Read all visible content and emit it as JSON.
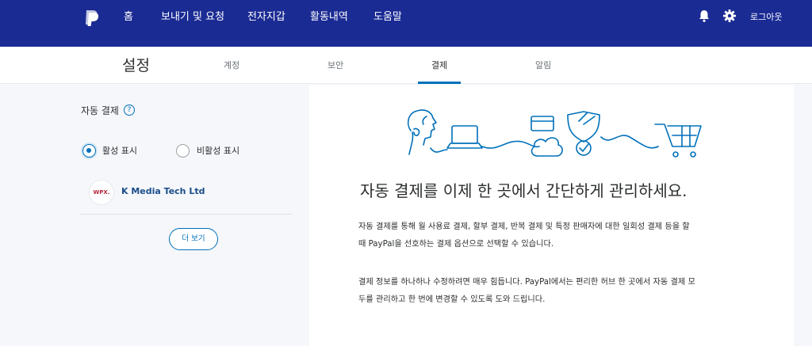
{
  "topnav": {
    "items": [
      "홈",
      "보내기 및 요청",
      "전자지갑",
      "활동내역",
      "도움말"
    ],
    "logout": "로그아웃",
    "icons": [
      "paypal-logo",
      "bell-icon",
      "gear-icon"
    ]
  },
  "subnav": {
    "title": "설정",
    "tabs": [
      "계정",
      "보안",
      "결제",
      "알림"
    ],
    "active_tab": "결제"
  },
  "left": {
    "auto_payments_label": "자동 결제",
    "help_symbol": "?",
    "radio_active_label": "활성 표시",
    "radio_inactive_label": "비활성 표시",
    "merchant_logo_text": "WPX.",
    "merchant_name": "K Media Tech Ltd",
    "more_button": "더 보기"
  },
  "right": {
    "heading": "자동 결제를 이제 한 곳에서 간단하게 관리하세요.",
    "para1_line1": "자동 결제를 통해 월 사용료 결제, 할부 결제, 반복 결제 및 특정 판매자에 대한 일회성 결제 등을 할",
    "para1_line2": "때 PayPal을 선호하는 결제 옵션으로 선택할 수 있습니다.",
    "para2_line1": "결제 정보를 하나하나 수정하려면 매우 힘듭니다. PayPal에서는 편리한 허브 한 곳에서 자동 결제 모",
    "para2_line2": "두를 관리하고 한 번에 변경할 수 있도록 도와 드립니다."
  },
  "colors": {
    "nav_bg": "#1b2b94",
    "accent": "#0070ba"
  }
}
